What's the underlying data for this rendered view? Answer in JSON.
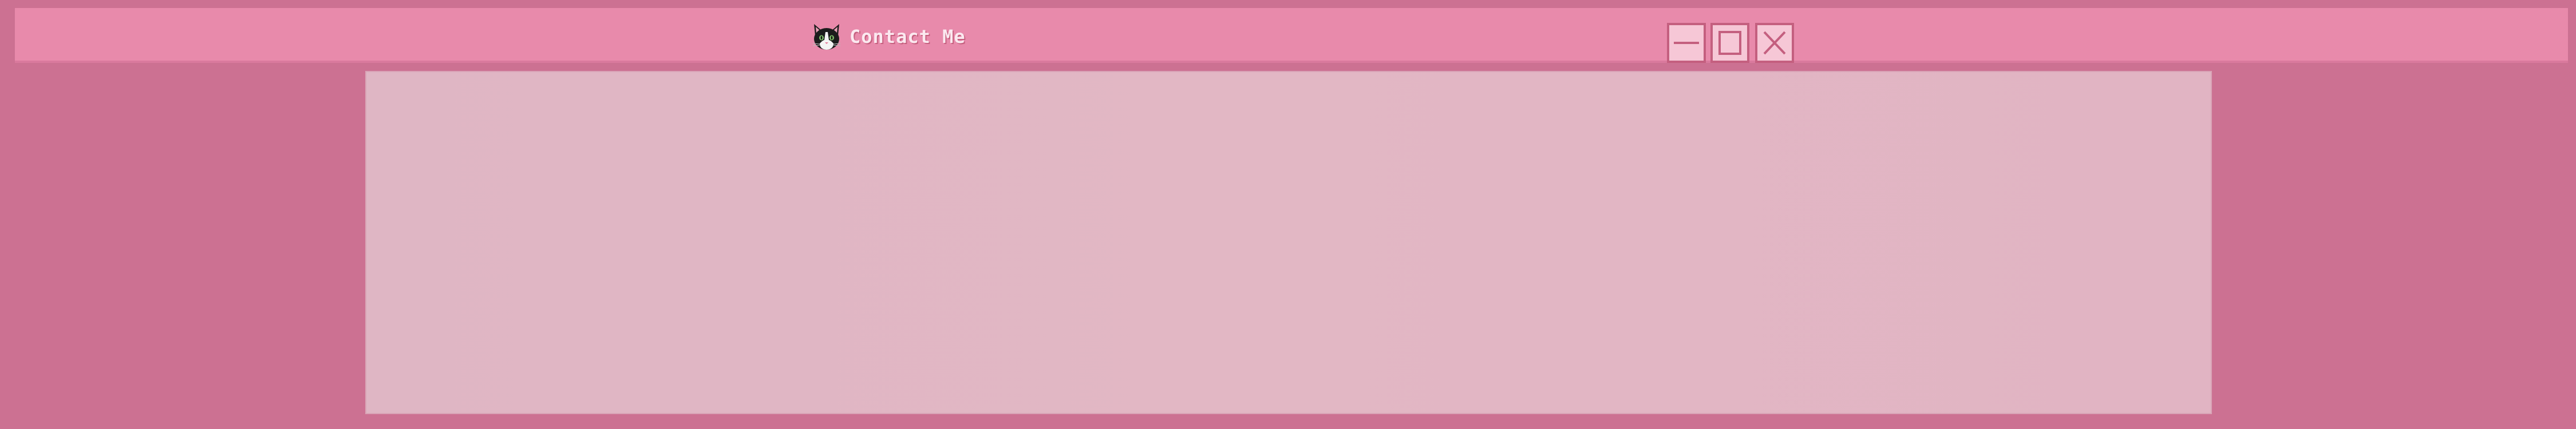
{
  "window": {
    "title": "Contact Me",
    "app_icon": "cat-face-icon",
    "controls": {
      "minimize_icon": "minimize-icon",
      "maximize_icon": "maximize-icon",
      "close_icon": "close-icon"
    }
  },
  "theme": {
    "desktop_bg": "#cc7192",
    "titlebar_bg": "#e88aab",
    "button_bg": "#f6c7d6",
    "button_border": "#c45f7f",
    "content_bg": "#e1b6c4"
  }
}
